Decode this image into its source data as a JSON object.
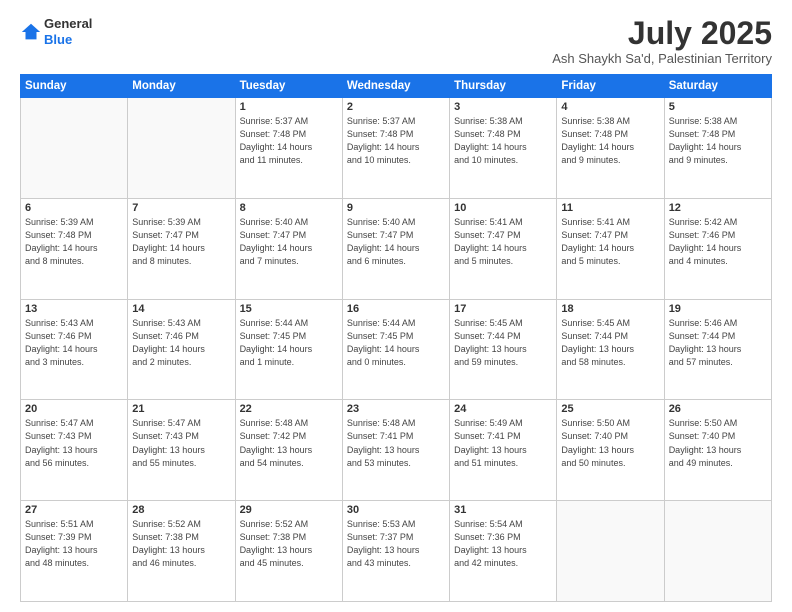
{
  "header": {
    "logo_line1": "General",
    "logo_line2": "Blue",
    "month": "July 2025",
    "location": "Ash Shaykh Sa'd, Palestinian Territory"
  },
  "weekdays": [
    "Sunday",
    "Monday",
    "Tuesday",
    "Wednesday",
    "Thursday",
    "Friday",
    "Saturday"
  ],
  "weeks": [
    [
      {
        "day": "",
        "info": ""
      },
      {
        "day": "",
        "info": ""
      },
      {
        "day": "1",
        "info": "Sunrise: 5:37 AM\nSunset: 7:48 PM\nDaylight: 14 hours\nand 11 minutes."
      },
      {
        "day": "2",
        "info": "Sunrise: 5:37 AM\nSunset: 7:48 PM\nDaylight: 14 hours\nand 10 minutes."
      },
      {
        "day": "3",
        "info": "Sunrise: 5:38 AM\nSunset: 7:48 PM\nDaylight: 14 hours\nand 10 minutes."
      },
      {
        "day": "4",
        "info": "Sunrise: 5:38 AM\nSunset: 7:48 PM\nDaylight: 14 hours\nand 9 minutes."
      },
      {
        "day": "5",
        "info": "Sunrise: 5:38 AM\nSunset: 7:48 PM\nDaylight: 14 hours\nand 9 minutes."
      }
    ],
    [
      {
        "day": "6",
        "info": "Sunrise: 5:39 AM\nSunset: 7:48 PM\nDaylight: 14 hours\nand 8 minutes."
      },
      {
        "day": "7",
        "info": "Sunrise: 5:39 AM\nSunset: 7:47 PM\nDaylight: 14 hours\nand 8 minutes."
      },
      {
        "day": "8",
        "info": "Sunrise: 5:40 AM\nSunset: 7:47 PM\nDaylight: 14 hours\nand 7 minutes."
      },
      {
        "day": "9",
        "info": "Sunrise: 5:40 AM\nSunset: 7:47 PM\nDaylight: 14 hours\nand 6 minutes."
      },
      {
        "day": "10",
        "info": "Sunrise: 5:41 AM\nSunset: 7:47 PM\nDaylight: 14 hours\nand 5 minutes."
      },
      {
        "day": "11",
        "info": "Sunrise: 5:41 AM\nSunset: 7:47 PM\nDaylight: 14 hours\nand 5 minutes."
      },
      {
        "day": "12",
        "info": "Sunrise: 5:42 AM\nSunset: 7:46 PM\nDaylight: 14 hours\nand 4 minutes."
      }
    ],
    [
      {
        "day": "13",
        "info": "Sunrise: 5:43 AM\nSunset: 7:46 PM\nDaylight: 14 hours\nand 3 minutes."
      },
      {
        "day": "14",
        "info": "Sunrise: 5:43 AM\nSunset: 7:46 PM\nDaylight: 14 hours\nand 2 minutes."
      },
      {
        "day": "15",
        "info": "Sunrise: 5:44 AM\nSunset: 7:45 PM\nDaylight: 14 hours\nand 1 minute."
      },
      {
        "day": "16",
        "info": "Sunrise: 5:44 AM\nSunset: 7:45 PM\nDaylight: 14 hours\nand 0 minutes."
      },
      {
        "day": "17",
        "info": "Sunrise: 5:45 AM\nSunset: 7:44 PM\nDaylight: 13 hours\nand 59 minutes."
      },
      {
        "day": "18",
        "info": "Sunrise: 5:45 AM\nSunset: 7:44 PM\nDaylight: 13 hours\nand 58 minutes."
      },
      {
        "day": "19",
        "info": "Sunrise: 5:46 AM\nSunset: 7:44 PM\nDaylight: 13 hours\nand 57 minutes."
      }
    ],
    [
      {
        "day": "20",
        "info": "Sunrise: 5:47 AM\nSunset: 7:43 PM\nDaylight: 13 hours\nand 56 minutes."
      },
      {
        "day": "21",
        "info": "Sunrise: 5:47 AM\nSunset: 7:43 PM\nDaylight: 13 hours\nand 55 minutes."
      },
      {
        "day": "22",
        "info": "Sunrise: 5:48 AM\nSunset: 7:42 PM\nDaylight: 13 hours\nand 54 minutes."
      },
      {
        "day": "23",
        "info": "Sunrise: 5:48 AM\nSunset: 7:41 PM\nDaylight: 13 hours\nand 53 minutes."
      },
      {
        "day": "24",
        "info": "Sunrise: 5:49 AM\nSunset: 7:41 PM\nDaylight: 13 hours\nand 51 minutes."
      },
      {
        "day": "25",
        "info": "Sunrise: 5:50 AM\nSunset: 7:40 PM\nDaylight: 13 hours\nand 50 minutes."
      },
      {
        "day": "26",
        "info": "Sunrise: 5:50 AM\nSunset: 7:40 PM\nDaylight: 13 hours\nand 49 minutes."
      }
    ],
    [
      {
        "day": "27",
        "info": "Sunrise: 5:51 AM\nSunset: 7:39 PM\nDaylight: 13 hours\nand 48 minutes."
      },
      {
        "day": "28",
        "info": "Sunrise: 5:52 AM\nSunset: 7:38 PM\nDaylight: 13 hours\nand 46 minutes."
      },
      {
        "day": "29",
        "info": "Sunrise: 5:52 AM\nSunset: 7:38 PM\nDaylight: 13 hours\nand 45 minutes."
      },
      {
        "day": "30",
        "info": "Sunrise: 5:53 AM\nSunset: 7:37 PM\nDaylight: 13 hours\nand 43 minutes."
      },
      {
        "day": "31",
        "info": "Sunrise: 5:54 AM\nSunset: 7:36 PM\nDaylight: 13 hours\nand 42 minutes."
      },
      {
        "day": "",
        "info": ""
      },
      {
        "day": "",
        "info": ""
      }
    ]
  ]
}
